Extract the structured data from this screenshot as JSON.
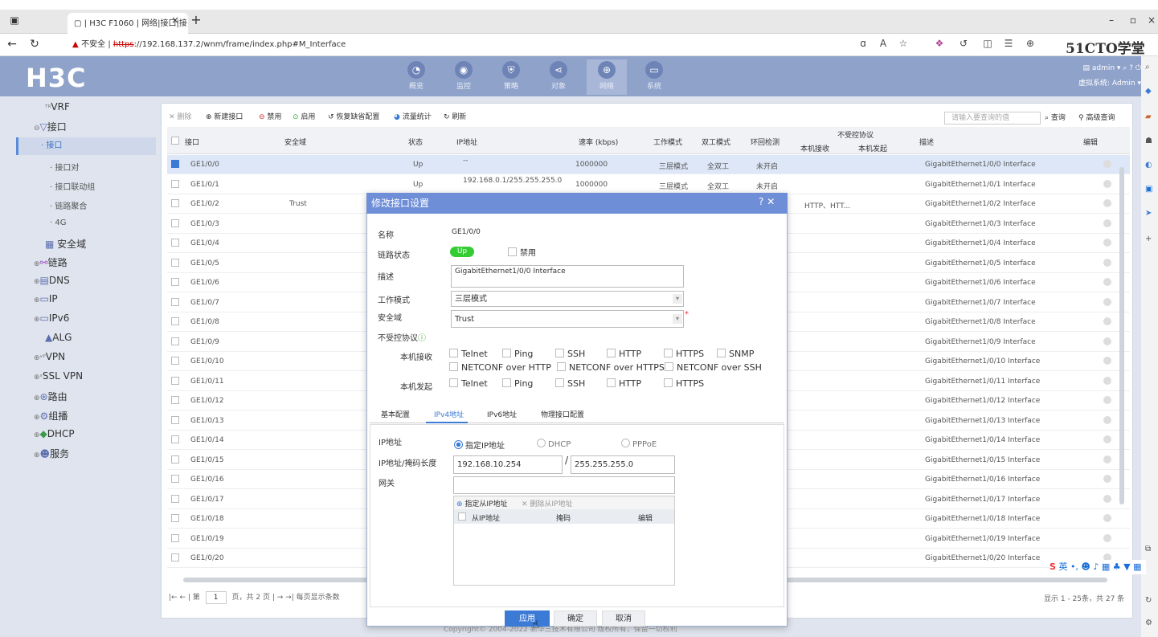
{
  "browser": {
    "tab_title": "| H3C F1060 | 网络|接口|接口",
    "new_tab": "+",
    "minimize": "–",
    "close": "×",
    "insecure_label": "不安全",
    "url_scheme": "https",
    "url_rest": "://192.168.137.2/wnm/frame/index.php#M_Interface",
    "brand_right": "51CTO学堂"
  },
  "app": {
    "logo": "H3C",
    "nav": [
      {
        "label": "概览",
        "icon": "gauge-icon"
      },
      {
        "label": "监控",
        "icon": "monitor-icon"
      },
      {
        "label": "策略",
        "icon": "shield-icon"
      },
      {
        "label": "对象",
        "icon": "share-icon"
      },
      {
        "label": "网络",
        "icon": "globe-icon"
      },
      {
        "label": "系统",
        "icon": "screen-icon"
      }
    ],
    "user": "admin ▾",
    "vsys": "虚拟系统: Admin ▾"
  },
  "sidebar": {
    "items": [
      {
        "label": "VRF"
      },
      {
        "label": "接口"
      },
      {
        "label": "· 接口"
      },
      {
        "label": "· 接口对"
      },
      {
        "label": "· 接口联动组"
      },
      {
        "label": "· 链路聚合"
      },
      {
        "label": "· 4G"
      },
      {
        "label": "安全域"
      },
      {
        "label": "链路"
      },
      {
        "label": "DNS"
      },
      {
        "label": "IP"
      },
      {
        "label": "IPv6"
      },
      {
        "label": "ALG"
      },
      {
        "label": "VPN"
      },
      {
        "label": "SSL VPN"
      },
      {
        "label": "路由"
      },
      {
        "label": "组播"
      },
      {
        "label": "DHCP"
      },
      {
        "label": "服务"
      }
    ]
  },
  "toolbar": {
    "delete": "删除",
    "new": "新建接口",
    "disable": "禁用",
    "enable": "启用",
    "restore": "恢复缺省配置",
    "traffic": "流量统计",
    "refresh": "刷新",
    "search_placeholder": "请输入要查询的值",
    "query": "查询",
    "advanced": "高级查询"
  },
  "table": {
    "headers": {
      "iface": "接口",
      "zone": "安全域",
      "status": "状态",
      "ip": "IP地址",
      "speed": "速率 (kbps)",
      "mode": "工作模式",
      "duplex": "双工模式",
      "loop": "环回检测",
      "unctrl": "不受控协议",
      "local_rx": "本机接收",
      "local_tx": "本机发起",
      "desc": "描述",
      "edit": "编辑"
    },
    "rows": [
      {
        "iface": "GE1/0/0",
        "zone": "",
        "status": "Up",
        "ip": "--",
        "speed": "1000000",
        "mode": "三层模式",
        "duplex": "全双工",
        "loop": "未开启",
        "rx": "",
        "desc": "GigabitEthernet1/0/0 Interface"
      },
      {
        "iface": "GE1/0/1",
        "zone": "",
        "status": "Up",
        "ip": "192.168.0.1/255.255.255.0",
        "speed": "1000000",
        "mode": "三层模式",
        "duplex": "全双工",
        "loop": "未开启",
        "rx": "",
        "desc": "GigabitEthernet1/0/1 Interface"
      },
      {
        "iface": "GE1/0/2",
        "zone": "Trust",
        "status": "",
        "ip": "",
        "speed": "",
        "mode": "",
        "duplex": "",
        "loop": "",
        "rx": "HTTP、HTT...",
        "desc": "GigabitEthernet1/0/2 Interface"
      },
      {
        "iface": "GE1/0/3",
        "zone": "",
        "status": "",
        "ip": "",
        "speed": "",
        "mode": "",
        "duplex": "",
        "loop": "",
        "rx": "",
        "desc": "GigabitEthernet1/0/3 Interface"
      },
      {
        "iface": "GE1/0/4",
        "zone": "",
        "status": "",
        "ip": "",
        "speed": "",
        "mode": "",
        "duplex": "",
        "loop": "",
        "rx": "",
        "desc": "GigabitEthernet1/0/4 Interface"
      },
      {
        "iface": "GE1/0/5",
        "zone": "",
        "status": "",
        "ip": "",
        "speed": "",
        "mode": "",
        "duplex": "",
        "loop": "",
        "rx": "",
        "desc": "GigabitEthernet1/0/5 Interface"
      },
      {
        "iface": "GE1/0/6",
        "zone": "",
        "status": "",
        "ip": "",
        "speed": "",
        "mode": "",
        "duplex": "",
        "loop": "",
        "rx": "",
        "desc": "GigabitEthernet1/0/6 Interface"
      },
      {
        "iface": "GE1/0/7",
        "zone": "",
        "status": "",
        "ip": "",
        "speed": "",
        "mode": "",
        "duplex": "",
        "loop": "",
        "rx": "",
        "desc": "GigabitEthernet1/0/7 Interface"
      },
      {
        "iface": "GE1/0/8",
        "zone": "",
        "status": "",
        "ip": "",
        "speed": "",
        "mode": "",
        "duplex": "",
        "loop": "",
        "rx": "",
        "desc": "GigabitEthernet1/0/8 Interface"
      },
      {
        "iface": "GE1/0/9",
        "zone": "",
        "status": "",
        "ip": "",
        "speed": "",
        "mode": "",
        "duplex": "",
        "loop": "",
        "rx": "",
        "desc": "GigabitEthernet1/0/9 Interface"
      },
      {
        "iface": "GE1/0/10",
        "zone": "",
        "status": "",
        "ip": "",
        "speed": "",
        "mode": "",
        "duplex": "",
        "loop": "",
        "rx": "",
        "desc": "GigabitEthernet1/0/10 Interface"
      },
      {
        "iface": "GE1/0/11",
        "zone": "",
        "status": "",
        "ip": "",
        "speed": "",
        "mode": "",
        "duplex": "",
        "loop": "",
        "rx": "",
        "desc": "GigabitEthernet1/0/11 Interface"
      },
      {
        "iface": "GE1/0/12",
        "zone": "",
        "status": "",
        "ip": "",
        "speed": "",
        "mode": "",
        "duplex": "",
        "loop": "",
        "rx": "",
        "desc": "GigabitEthernet1/0/12 Interface"
      },
      {
        "iface": "GE1/0/13",
        "zone": "",
        "status": "",
        "ip": "",
        "speed": "",
        "mode": "",
        "duplex": "",
        "loop": "",
        "rx": "",
        "desc": "GigabitEthernet1/0/13 Interface"
      },
      {
        "iface": "GE1/0/14",
        "zone": "",
        "status": "",
        "ip": "",
        "speed": "",
        "mode": "",
        "duplex": "",
        "loop": "",
        "rx": "",
        "desc": "GigabitEthernet1/0/14 Interface"
      },
      {
        "iface": "GE1/0/15",
        "zone": "",
        "status": "",
        "ip": "",
        "speed": "",
        "mode": "",
        "duplex": "",
        "loop": "",
        "rx": "",
        "desc": "GigabitEthernet1/0/15 Interface"
      },
      {
        "iface": "GE1/0/16",
        "zone": "",
        "status": "",
        "ip": "",
        "speed": "",
        "mode": "",
        "duplex": "",
        "loop": "",
        "rx": "",
        "desc": "GigabitEthernet1/0/16 Interface"
      },
      {
        "iface": "GE1/0/17",
        "zone": "",
        "status": "",
        "ip": "",
        "speed": "",
        "mode": "",
        "duplex": "",
        "loop": "",
        "rx": "",
        "desc": "GigabitEthernet1/0/17 Interface"
      },
      {
        "iface": "GE1/0/18",
        "zone": "",
        "status": "",
        "ip": "",
        "speed": "",
        "mode": "",
        "duplex": "",
        "loop": "",
        "rx": "",
        "desc": "GigabitEthernet1/0/18 Interface"
      },
      {
        "iface": "GE1/0/19",
        "zone": "",
        "status": "",
        "ip": "",
        "speed": "",
        "mode": "",
        "duplex": "",
        "loop": "",
        "rx": "",
        "desc": "GigabitEthernet1/0/19 Interface"
      },
      {
        "iface": "GE1/0/20",
        "zone": "",
        "status": "",
        "ip": "",
        "speed": "",
        "mode": "",
        "duplex": "",
        "loop": "",
        "rx": "",
        "desc": "GigabitEthernet1/0/20 Interface"
      }
    ]
  },
  "pager": {
    "page_label": "第",
    "page": "1",
    "total": "页，共 2 页",
    "per_page": "每页显示条数",
    "summary": "显示 1 - 25条，共 27 条"
  },
  "footer": "Copyright© 2004-2022 新华三技术有限公司 版权所有，保留一切权利",
  "modal": {
    "title": "修改接口设置",
    "name_label": "名称",
    "name_value": "GE1/0/0",
    "link_label": "链路状态",
    "link_value": "Up",
    "disable": "禁用",
    "desc_label": "描述",
    "desc_value": "GigabitEthernet1/0/0 Interface",
    "mode_label": "工作模式",
    "mode_value": "三层模式",
    "zone_label": "安全域",
    "zone_value": "Trust",
    "unctrl_label": "不受控协议",
    "rx_label": "本机接收",
    "tx_label": "本机发起",
    "rx_options": [
      "Telnet",
      "Ping",
      "SSH",
      "HTTP",
      "HTTPS",
      "SNMP",
      "NETCONF over HTTP",
      "NETCONF over HTTPS",
      "NETCONF over SSH"
    ],
    "tx_options": [
      "Telnet",
      "Ping",
      "SSH",
      "HTTP",
      "HTTPS"
    ],
    "tabs": [
      "基本配置",
      "IPv4地址",
      "IPv6地址",
      "物理接口配置"
    ],
    "ip_label": "IP地址",
    "ip_mode_static": "指定IP地址",
    "ip_mode_dhcp": "DHCP",
    "ip_mode_pppoe": "PPPoE",
    "mask_label": "IP地址/掩码长度",
    "ip_value": "192.168.10.254",
    "slash": "/",
    "mask_value": "255.255.255.0",
    "gw_label": "网关",
    "gw_value": "",
    "add_slave": "指定从IP地址",
    "del_slave": "删除从IP地址",
    "slave_col_ip": "从IP地址",
    "slave_col_mask": "掩码",
    "slave_col_edit": "编辑",
    "apply": "应用",
    "ok": "确定",
    "cancel": "取消"
  },
  "ime": {
    "label": "英"
  }
}
